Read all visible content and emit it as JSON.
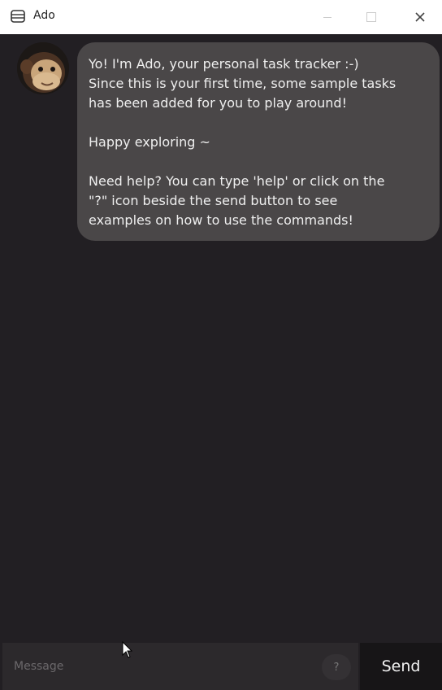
{
  "window": {
    "title": "Ado",
    "app_icon": "window-app-icon",
    "controls": [
      "minimize-icon",
      "maximize-icon",
      "close-icon"
    ]
  },
  "chat": {
    "messages": [
      {
        "sender": "bot",
        "avatar": "monkey-avatar",
        "text": "Yo! I'm Ado, your personal task tracker :-)\nSince this is your first time, some sample tasks\nhas been added for you to play around!\n\nHappy exploring ~\n\nNeed help? You can type 'help' or click on the\n\"?\" icon beside the send button to see\nexamples on how to use the commands!"
      }
    ]
  },
  "input": {
    "placeholder": "Message",
    "value": "",
    "help_label": "?",
    "send_label": "Send"
  },
  "colors": {
    "background": "#221f23",
    "bubble": "#4a4748",
    "send_button": "#171517",
    "titlebar": "#ffffff"
  }
}
